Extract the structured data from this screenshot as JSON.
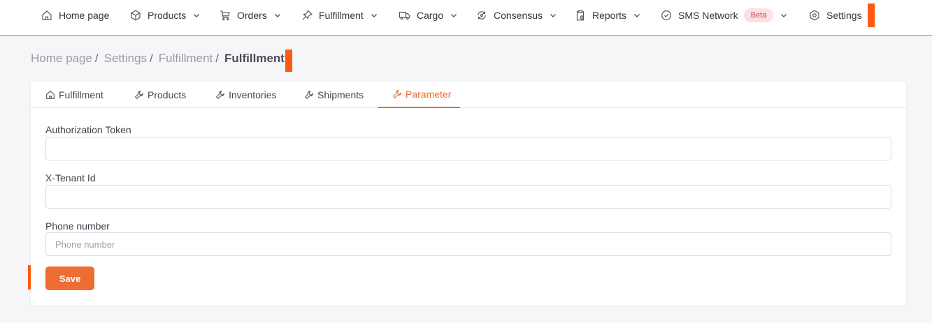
{
  "nav": {
    "items": [
      {
        "label": "Home page",
        "icon": "home-icon",
        "has_dropdown": false
      },
      {
        "label": "Products",
        "icon": "box-icon",
        "has_dropdown": true
      },
      {
        "label": "Orders",
        "icon": "cart-icon",
        "has_dropdown": true
      },
      {
        "label": "Fulfillment",
        "icon": "pin-icon",
        "has_dropdown": true
      },
      {
        "label": "Cargo",
        "icon": "truck-icon",
        "has_dropdown": true
      },
      {
        "label": "Consensus",
        "icon": "sync-icon",
        "has_dropdown": true
      },
      {
        "label": "Reports",
        "icon": "clipboard-icon",
        "has_dropdown": true
      },
      {
        "label": "SMS Network",
        "icon": "check-circle-icon",
        "has_dropdown": true,
        "badge": "Beta"
      },
      {
        "label": "Settings",
        "icon": "hexagon-settings-icon",
        "has_dropdown": false
      }
    ]
  },
  "breadcrumb": {
    "items": [
      "Home page",
      "Settings",
      "Fulfillment"
    ],
    "separator": "/",
    "current": "Fulfillment"
  },
  "tabs": [
    {
      "label": "Fulfillment",
      "icon": "home-icon",
      "active": false
    },
    {
      "label": "Products",
      "icon": "wrench-icon",
      "active": false
    },
    {
      "label": "Inventories",
      "icon": "wrench-icon",
      "active": false
    },
    {
      "label": "Shipments",
      "icon": "wrench-icon",
      "active": false
    },
    {
      "label": "Parameter",
      "icon": "wrench-icon",
      "active": true
    }
  ],
  "form": {
    "fields": [
      {
        "label": "Authorization Token",
        "value": "",
        "placeholder": ""
      },
      {
        "label": "X-Tenant Id",
        "value": "",
        "placeholder": ""
      },
      {
        "label": "Phone number",
        "value": "",
        "placeholder": "Phone number"
      }
    ],
    "save_label": "Save"
  },
  "colors": {
    "accent": "#ee6d33",
    "marker": "#ff5a12",
    "badge_bg": "#fbe1e0",
    "badge_text": "#c84949"
  }
}
